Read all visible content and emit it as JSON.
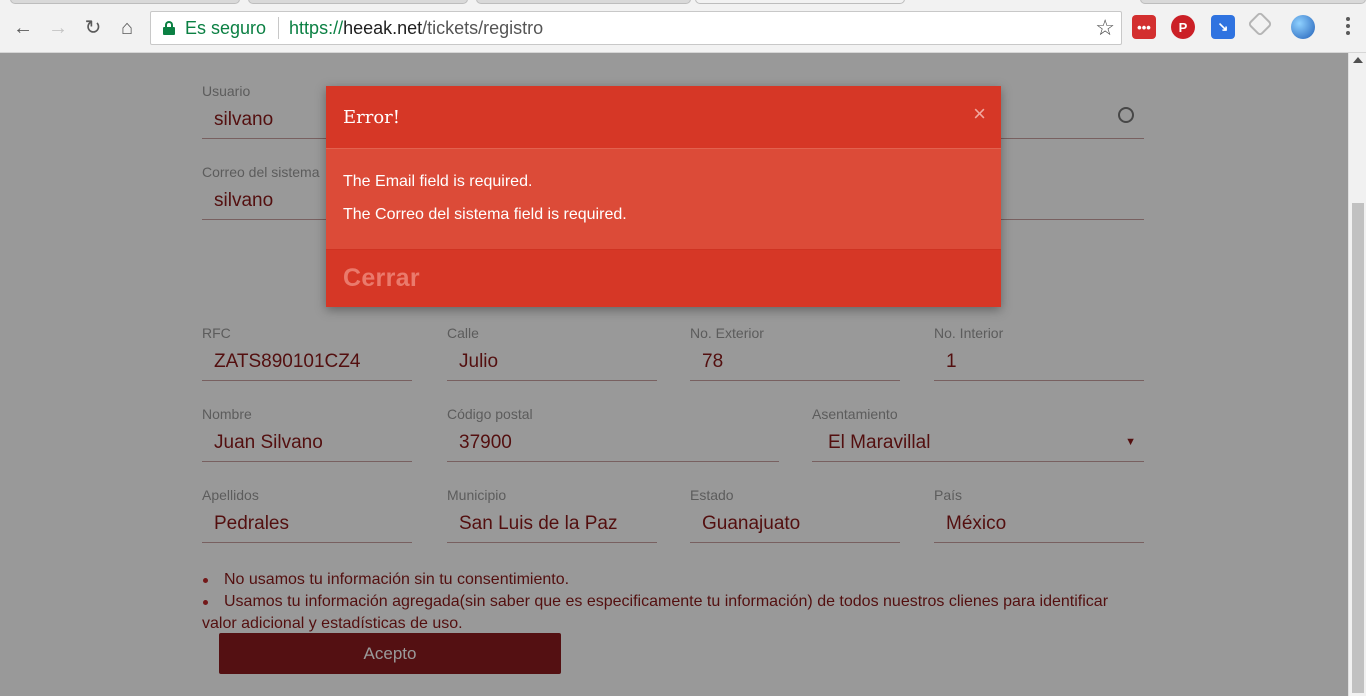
{
  "browser": {
    "secure_label": "Es seguro",
    "url_scheme": "https://",
    "url_host": "heeak.net",
    "url_path": "/tickets/registro",
    "back_icon": "←",
    "forward_icon": "→",
    "reload_icon": "↻",
    "home_icon": "⌂",
    "star_icon": "☆"
  },
  "form": {
    "usuario": {
      "label": "Usuario",
      "value": "silvano"
    },
    "correo": {
      "label": "Correo del sistema",
      "value": "silvano"
    },
    "rfc": {
      "label": "RFC",
      "value": "ZATS890101CZ4"
    },
    "calle": {
      "label": "Calle",
      "value": "Julio"
    },
    "no_exterior": {
      "label": "No. Exterior",
      "value": "78"
    },
    "no_interior": {
      "label": "No. Interior",
      "value": "1"
    },
    "nombre": {
      "label": "Nombre",
      "value": "Juan Silvano"
    },
    "codigo_postal": {
      "label": "Código postal",
      "value": "37900"
    },
    "asentamiento": {
      "label": "Asentamiento",
      "value": "El Maravillal",
      "arrow": "▼"
    },
    "apellidos": {
      "label": "Apellidos",
      "value": "Pedrales"
    },
    "municipio": {
      "label": "Municipio",
      "value": "San Luis de la Paz"
    },
    "estado": {
      "label": "Estado",
      "value": "Guanajuato"
    },
    "pais": {
      "label": "País",
      "value": "México"
    }
  },
  "notes": [
    "No usamos tu información sin tu consentimiento.",
    "Usamos tu información agregada(sin saber que es especificamente tu información) de todos nuestros clienes para identificar valor adicional y estadísticas de uso."
  ],
  "accept_label": "Acepto",
  "modal": {
    "title": "Error!",
    "close_icon": "×",
    "messages": [
      "The Email field is required.",
      "The Correo del sistema field is required."
    ],
    "footer_label": "Cerrar"
  },
  "colors": {
    "accent": "#8d1c1f",
    "modal_header": "#d63726",
    "modal_body": "#dc4b38"
  }
}
